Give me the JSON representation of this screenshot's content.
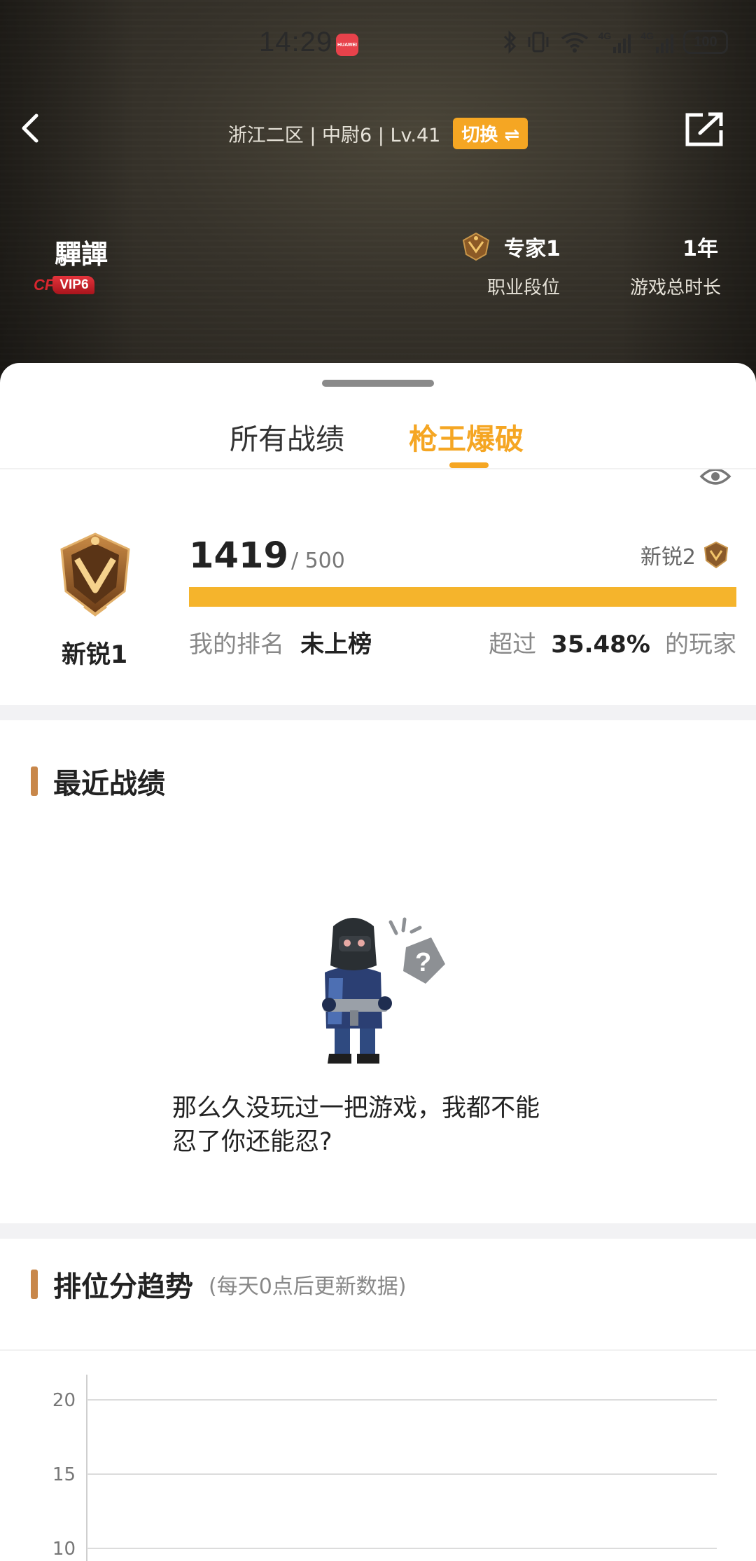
{
  "status_bar": {
    "time": "14:29",
    "app_icon_label": "HUAWEI",
    "network_1": "4G",
    "network_2": "4G",
    "battery": "100"
  },
  "header": {
    "server_info": "浙江二区 | 中尉6 | Lv.41",
    "switch_label": "切换 ⇌",
    "player_name": "驒譂",
    "vip_logo": "CF",
    "vip_label": "VIP6",
    "rank_value": "专家1",
    "rank_label": "职业段位",
    "time_value": "1年",
    "time_label": "游戏总时长"
  },
  "tabs": [
    {
      "label": "所有战绩",
      "active": false
    },
    {
      "label": "枪王爆破",
      "active": true
    }
  ],
  "rank_card": {
    "rank_name": "新锐1",
    "score": "1419",
    "score_max": "/ 500",
    "progress_fraction": 1.0,
    "next_rank": "新锐2",
    "my_rank_label": "我的排名",
    "my_rank_value": "未上榜",
    "exceed_prefix": "超过",
    "exceed_value": "35.48%",
    "exceed_suffix": "的玩家"
  },
  "recent": {
    "title": "最近战绩",
    "empty_line_1": "那么久没玩过一把游戏，我都不能",
    "empty_line_2": "忍了你还能忍?"
  },
  "trend": {
    "title": "排位分趋势",
    "subtitle": "(每天0点后更新数据)"
  },
  "chart_data": {
    "type": "line",
    "title": "",
    "xlabel": "",
    "ylabel": "",
    "y_ticks": [
      20,
      15,
      10
    ],
    "ylim": [
      10,
      20
    ],
    "grid": true,
    "series": []
  },
  "colors": {
    "accent": "#f5a623",
    "progress": "#f5b42c",
    "section_bar": "#c8874a",
    "vip_red": "#d7262e"
  }
}
